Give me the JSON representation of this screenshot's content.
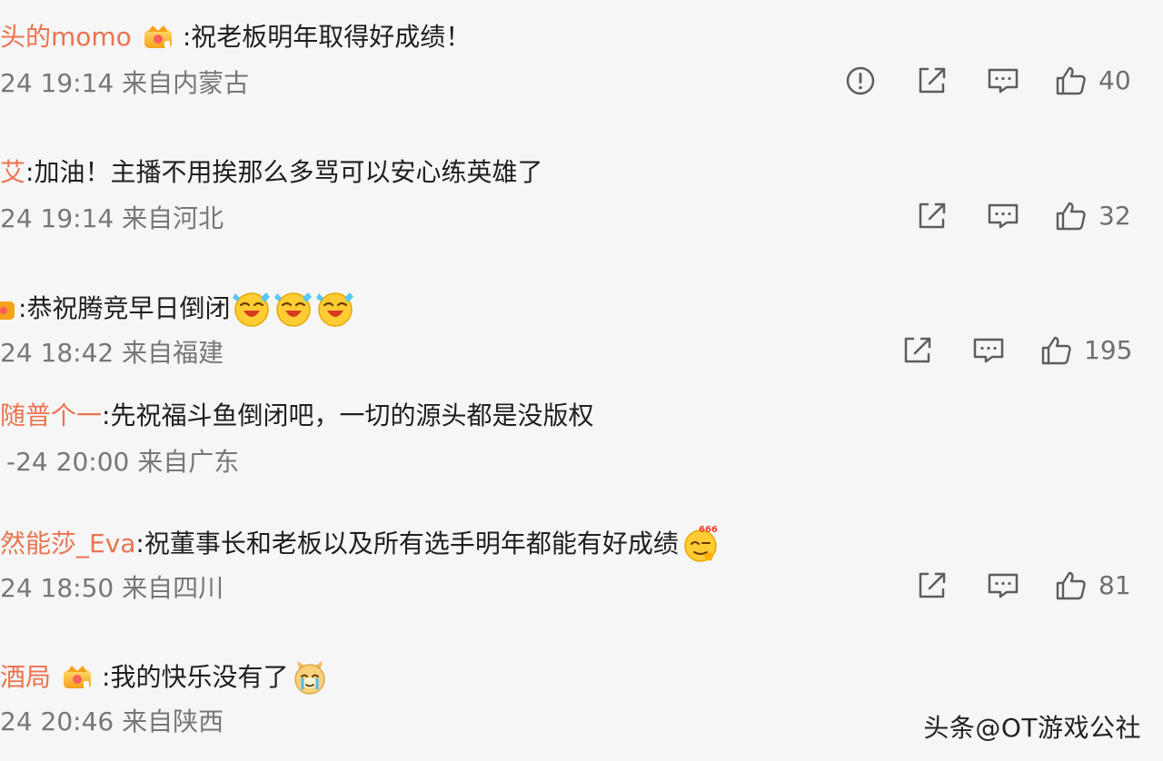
{
  "comments": [
    {
      "username": "头的momo",
      "separator": ":",
      "text": "祝老板明年取得好成绩！",
      "meta": "24 19:14 来自内蒙古",
      "likes": "40"
    },
    {
      "username": "艾",
      "separator": ":",
      "text": "加油！主播不用挨那么多骂可以安心练英雄了",
      "meta": "24 19:14 来自河北",
      "likes": "32"
    },
    {
      "username": "",
      "separator": ":",
      "text": "恭祝腾竞早日倒闭",
      "meta": "24 18:42 来自福建",
      "likes": "195"
    },
    {
      "username": "随普个一",
      "separator": ":",
      "text": "先祝福斗鱼倒闭吧，一切的源头都是没版权",
      "meta": "-24 20:00 来自广东",
      "likes": ""
    },
    {
      "username": "然能莎_Eva",
      "separator": ":",
      "text": "祝董事长和老板以及所有选手明年都能有好成绩",
      "meta": "24 18:50 来自四川",
      "likes": "81"
    },
    {
      "username": "酒局",
      "separator": ":",
      "text": "我的快乐没有了",
      "meta": "24 20:46 来自陕西",
      "likes": ""
    }
  ],
  "watermark": "头条@OT游戏公社",
  "colors": {
    "username": "#eb7350",
    "text": "#1f1f1f",
    "meta": "#777777",
    "icon": "#6f6f6f",
    "background": "#f6f6f6"
  }
}
